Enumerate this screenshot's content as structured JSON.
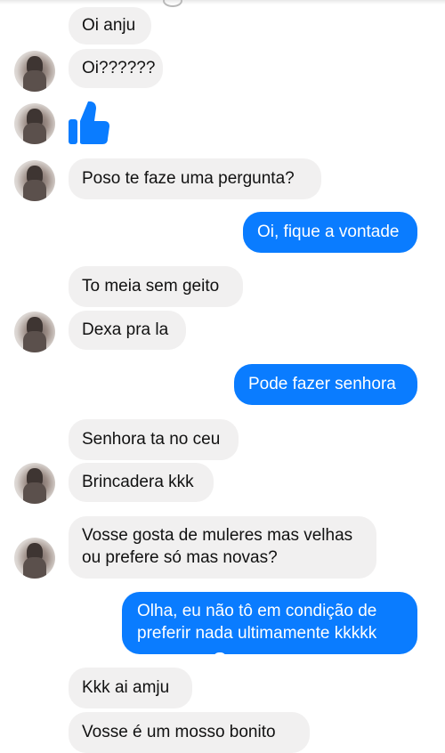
{
  "colors": {
    "incoming_bubble": "#f1f0f0",
    "outgoing_bubble": "#0a7cff",
    "like_icon": "#0a7cff"
  },
  "messages": [
    {
      "from": "them",
      "text": "Oi anju"
    },
    {
      "from": "them",
      "text": "Oi??????"
    },
    {
      "from": "them",
      "icon": "thumbs-up-icon"
    },
    {
      "from": "them",
      "text": "Poso te faze uma pergunta?"
    },
    {
      "from": "me",
      "text": "Oi, fique a vontade"
    },
    {
      "from": "them",
      "text": "To meia sem geito"
    },
    {
      "from": "them",
      "text": "Dexa pra la"
    },
    {
      "from": "me",
      "text": "Pode fazer senhora"
    },
    {
      "from": "them",
      "text": "Senhora ta no ceu"
    },
    {
      "from": "them",
      "text": "Brincadera kkk"
    },
    {
      "from": "them",
      "text": "Vosse gosta de muleres mas velhas ou prefere só mas novas?"
    },
    {
      "from": "me",
      "text": "Olha, eu não tô em condição de preferir nada ultimamente kkkkk"
    },
    {
      "from": "them",
      "text": "Kkk ai amju"
    },
    {
      "from": "them",
      "text": "Vosse é um mosso bonito"
    }
  ]
}
